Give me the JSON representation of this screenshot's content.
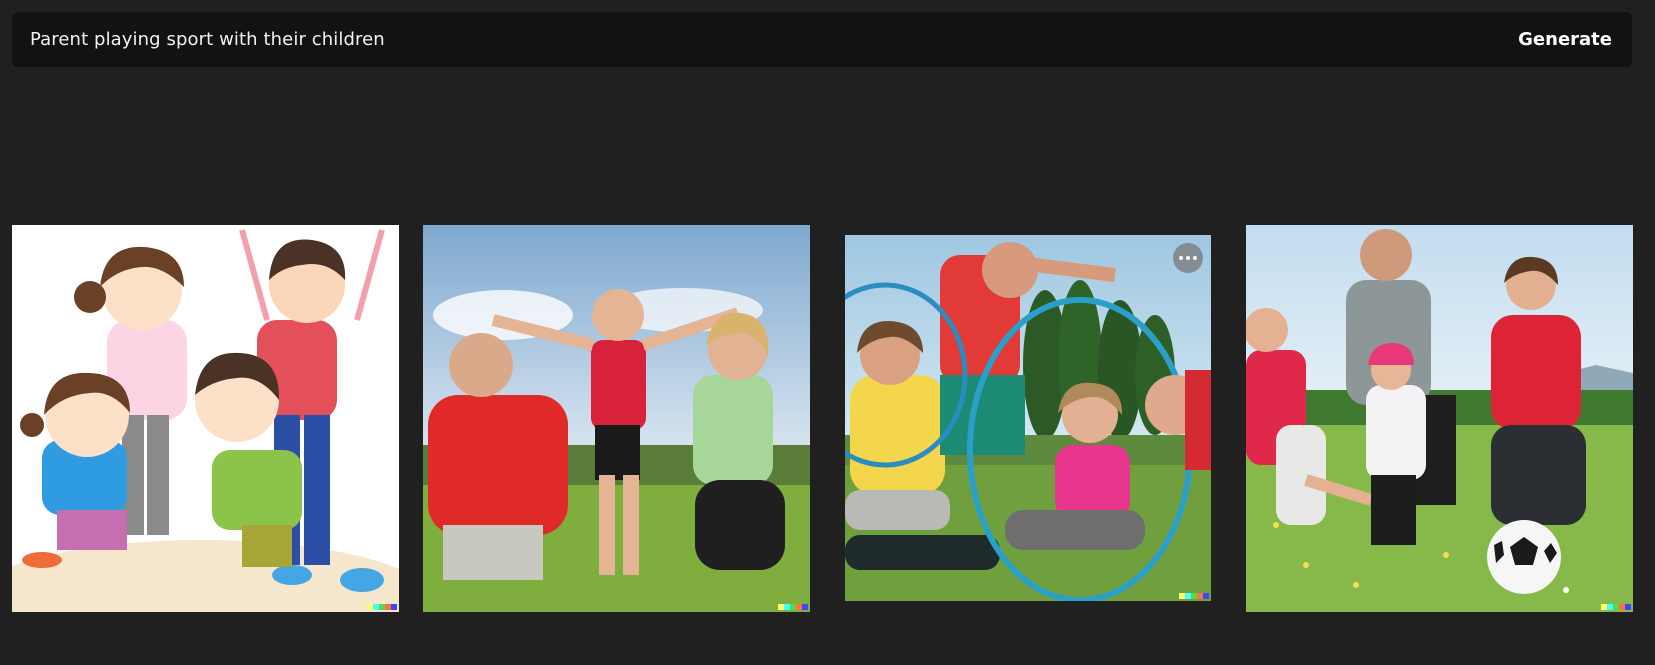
{
  "prompt": {
    "text": "Parent playing sport with their children"
  },
  "generate_label": "Generate",
  "images": [
    {
      "style": "cartoon illustration"
    },
    {
      "style": "photo"
    },
    {
      "style": "photo",
      "hovered": true
    },
    {
      "style": "photo"
    }
  ],
  "signature_colors": [
    "#ffff66",
    "#42ffff",
    "#51da4c",
    "#ff6e3c",
    "#3c46ff"
  ]
}
